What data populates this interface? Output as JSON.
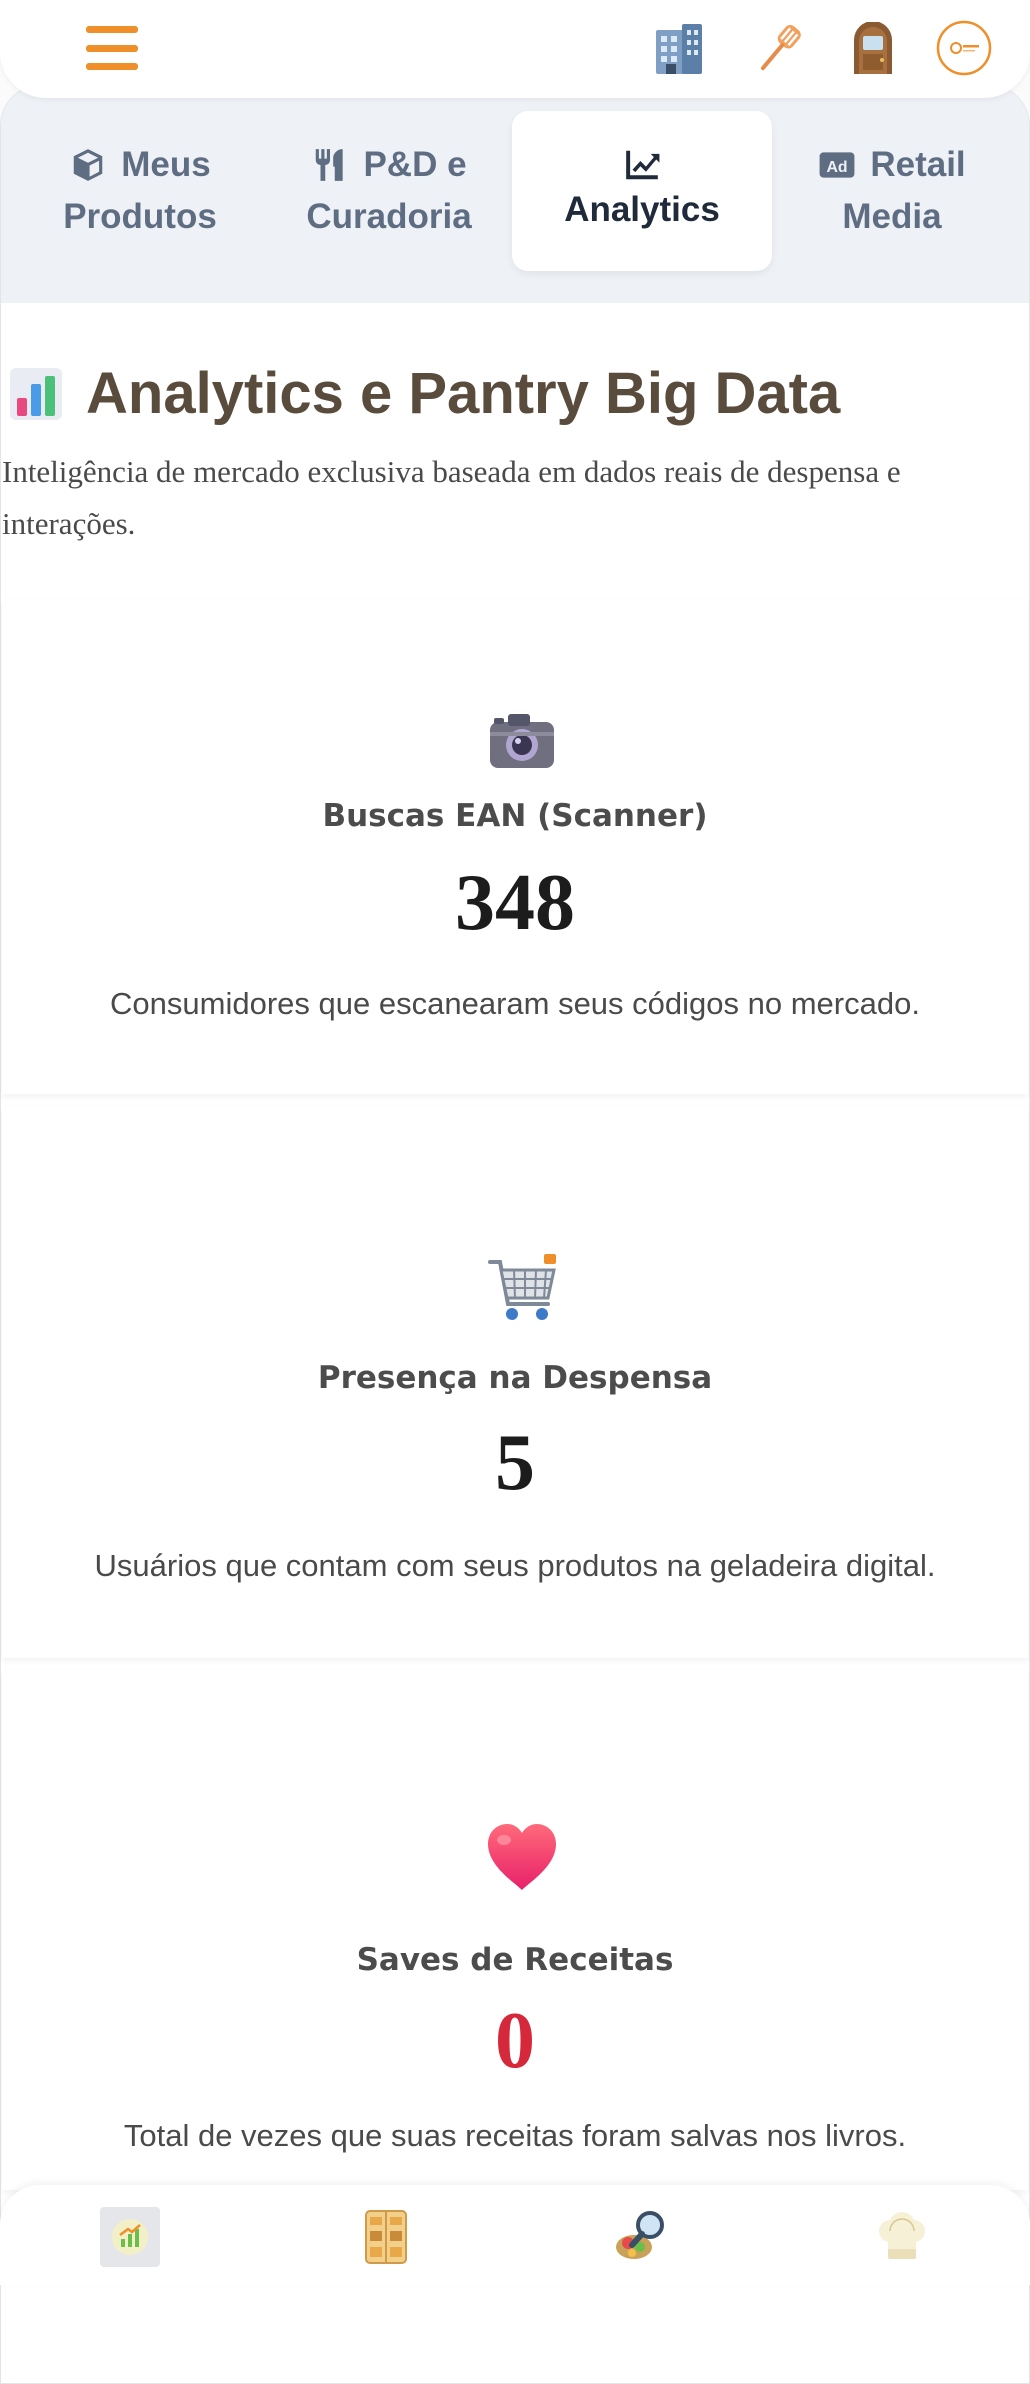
{
  "tabs": [
    {
      "icon": "cube-icon",
      "line1": "Meus",
      "line2": "Produtos"
    },
    {
      "icon": "utensils-icon",
      "line1": "P&D e",
      "line2": "Curadoria"
    },
    {
      "icon": "chart-line-icon",
      "line1": "",
      "line2": "Analytics"
    },
    {
      "icon": "ad-icon",
      "line1": "Retail",
      "line2": "Media"
    }
  ],
  "active_tab": "Analytics",
  "page": {
    "title": "Analytics e Pantry Big Data",
    "subtitle": "Inteligência de mercado exclusiva baseada em dados reais de despensa e interações."
  },
  "metrics": [
    {
      "icon": "camera-icon",
      "title": "Buscas EAN (Scanner)",
      "value": "348",
      "description": "Consumidores que escanearam seus códigos no mercado."
    },
    {
      "icon": "cart-icon",
      "title": "Presença na Despensa",
      "value": "5",
      "description": "Usuários que contam com seus produtos na geladeira digital."
    },
    {
      "icon": "heart-icon",
      "title": "Saves de Receitas",
      "value": "0",
      "description": "Total de vezes que suas receitas foram salvas nos livros."
    }
  ],
  "colors": {
    "accent": "#ef8f29",
    "tab_text": "#5f6d83",
    "heading": "#5a4c3c",
    "zero_value": "#d5283a"
  },
  "top_icons": [
    "menu-icon",
    "building-icon",
    "spatula-icon",
    "door-icon",
    "brand-logo"
  ],
  "bottom_nav": [
    "dashboard-icon",
    "fridge-icon",
    "search-food-icon",
    "chef-hat-icon"
  ]
}
